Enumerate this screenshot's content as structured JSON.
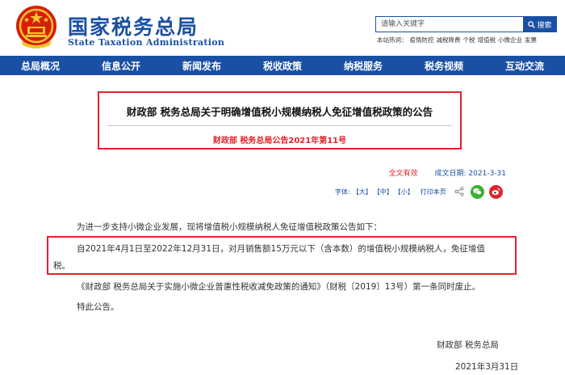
{
  "header": {
    "logo_cn": "国家税务总局",
    "logo_en": "State Taxation Administration",
    "search": {
      "placeholder": "请输入关键字",
      "button_label": "搜索"
    },
    "hot_words_label": "本站热词：",
    "hot_words": [
      "疫情防控",
      "减税降费",
      "个税",
      "增值税",
      "小微企业",
      "发票"
    ]
  },
  "nav": {
    "items": [
      "总局概况",
      "信息公开",
      "新闻发布",
      "税收政策",
      "纳税服务",
      "税务视频",
      "互动交流"
    ]
  },
  "article": {
    "title": "财政部 税务总局关于明确增值税小规模纳税人免征增值税政策的公告",
    "subtitle": "财政部 税务总局公告2021年第11号",
    "validity": "全文有效",
    "date_label": "成文日期:",
    "date_value": "2021-3-31",
    "tools": {
      "font_label": "字体:",
      "large": "【大】",
      "medium": "【中】",
      "small": "【小】",
      "print": "打印本页"
    },
    "paragraphs": {
      "p1": "为进一步支持小微企业发展，现将增值税小规模纳税人免征增值税政策公告如下：",
      "p2_line1": "自2021年4月1日至2022年12月31日，对月销售额15万元以下（含本数）的增值税小规模纳税人，免征增值",
      "p2_line2": "税。",
      "p3": "《财政部 税务总局关于实施小微企业普惠性税收减免政策的通知》（财税〔2019〕13号）第一条同时废止。",
      "p4": "特此公告。"
    },
    "signature": "财政部 税务总局",
    "sign_date": "2021年3月31日"
  },
  "colors": {
    "brand_blue": "#1a50a4",
    "accent_red": "#e2232a"
  }
}
